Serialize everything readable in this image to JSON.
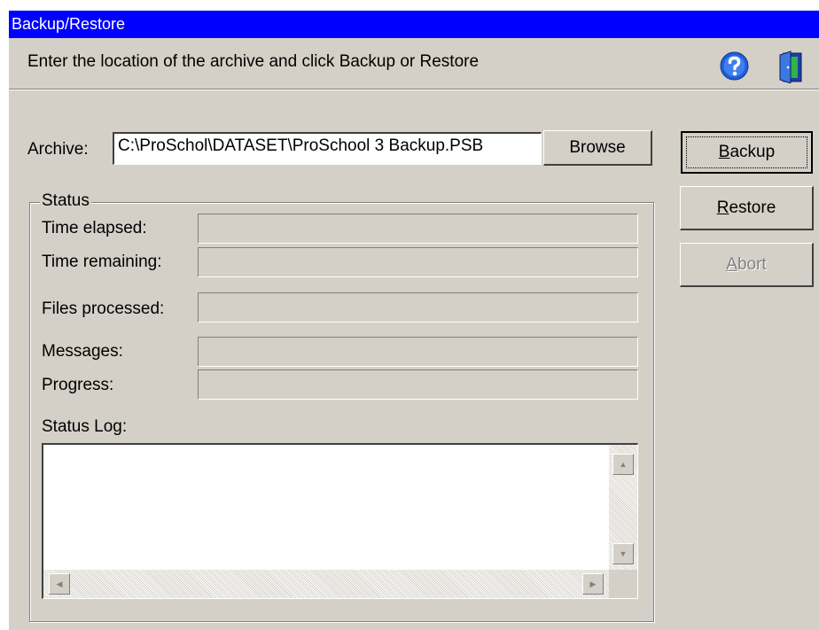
{
  "window": {
    "title": "Backup/Restore"
  },
  "header": {
    "instruction": "Enter the location of the archive and click Backup or Restore",
    "help_icon": "question-mark-circle",
    "exit_icon": "exit-door"
  },
  "archive": {
    "label": "Archive:",
    "value": "C:\\ProSchol\\DATASET\\ProSchool 3 Backup.PSB",
    "browse_label": "Browse"
  },
  "actions": {
    "backup": {
      "accel": "B",
      "rest": "ackup"
    },
    "restore": {
      "accel": "R",
      "rest": "estore"
    },
    "abort": {
      "accel": "A",
      "rest": "bort"
    }
  },
  "status": {
    "group_title": "Status",
    "time_elapsed_label": "Time elapsed:",
    "time_remaining_label": "Time remaining:",
    "files_processed_label": "Files processed:",
    "messages_label": "Messages:",
    "progress_label": "Progress:",
    "progress_value": 0,
    "status_log_label": "Status Log:"
  },
  "colors": {
    "title_bar": "#0000ff",
    "face": "#d4d0c8",
    "help_blue": "#1f5fd6",
    "exit_green": "#2fb34a"
  }
}
